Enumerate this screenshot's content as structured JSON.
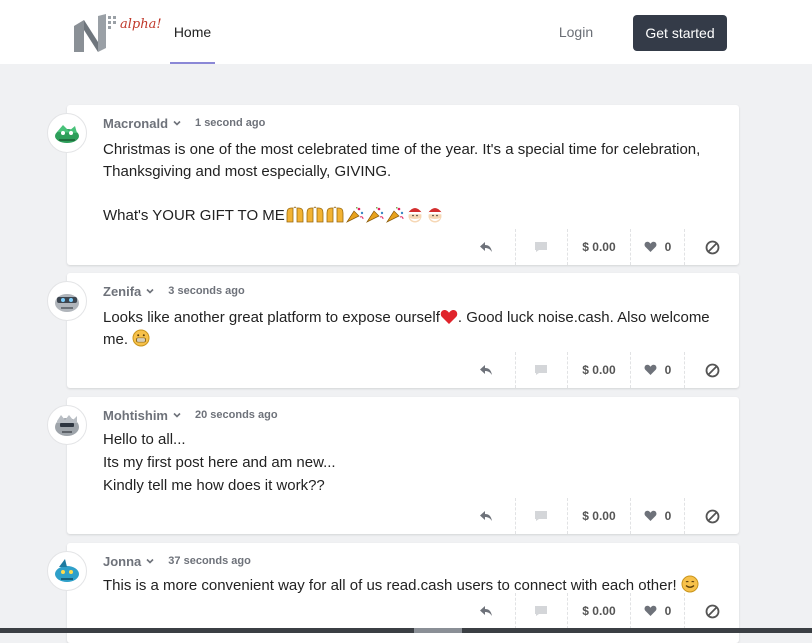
{
  "header": {
    "logo_text": "alpha!",
    "nav_home": "Home",
    "login": "Login",
    "get_started": "Get started"
  },
  "colors": {
    "accent": "#343b48",
    "underline": "#8b88d6",
    "background": "#f0f1f3"
  },
  "posts": [
    {
      "user": "Macronald",
      "time": "1 second ago",
      "text": "Christmas is one of the most celebrated time of the year. It's a special time for celebration, Thanksgiving and most especially, GIVING.\n\nWhat's YOUR GIFT TO ME",
      "emojis": [
        "raising-hands-icon",
        "raising-hands-icon",
        "raising-hands-icon",
        "party-popper-icon",
        "party-popper-icon",
        "party-popper-icon",
        "santa-icon",
        "santa-icon"
      ],
      "tip": "$ 0.00",
      "likes": "0"
    },
    {
      "user": "Zenifa",
      "time": "3 seconds ago",
      "text_before": "Looks like another great platform to expose ourself",
      "text_after": ". Good luck noise.cash. Also welcome me.",
      "tip": "$ 0.00",
      "likes": "0"
    },
    {
      "user": "Mohtishim",
      "time": "20 seconds ago",
      "text": "Hello to all...\nIts my first post here and am new...\nKindly tell me how does it work??",
      "tip": "$ 0.00",
      "likes": "0"
    },
    {
      "user": "Jonna",
      "time": "37 seconds ago",
      "text": "This is a more convenient way for all of us read.cash users to connect with each other!",
      "tip": "$ 0.00",
      "likes": "0"
    }
  ]
}
